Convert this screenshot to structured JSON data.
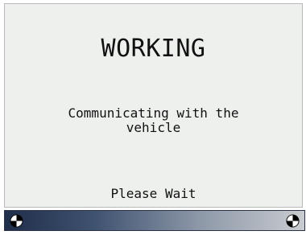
{
  "screen": {
    "title": "WORKING",
    "message": "Communicating with the\nvehicle",
    "wait_text": "Please Wait"
  },
  "status_bar": {
    "left_icon": "busy-spinner-icon",
    "right_icon": "busy-spinner-icon",
    "gradient_start": "#1f2e4a",
    "gradient_end": "#c9ccd0"
  },
  "colors": {
    "panel_background": "#eef0ee",
    "text": "#111111"
  }
}
